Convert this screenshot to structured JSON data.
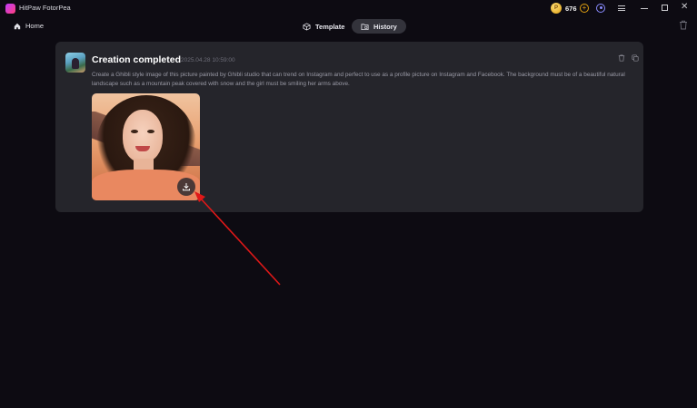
{
  "app": {
    "title": "HitPaw FotorPea",
    "credits": "676",
    "coin_symbol": "P",
    "add_symbol": "+",
    "close_symbol": "✕"
  },
  "nav": {
    "home_label": "Home",
    "tabs": [
      {
        "label": "Template",
        "icon": "cube-icon",
        "active": false
      },
      {
        "label": "History",
        "icon": "folder-clock-icon",
        "active": true
      }
    ]
  },
  "card": {
    "title": "Creation completed",
    "timestamp": "2025.04.28 10:59:00",
    "prompt": "Create a Ghibli style image of this picture painted by Ghibli studio that can trend on Instagram and perfect to use as a profile picture on Instagram and Facebook. The background must be of a beautiful natural landscape such as a mountain peak covered with snow and the girl must be smiling her arms above.",
    "image_alt": "generated Ghibli-style portrait"
  },
  "colors": {
    "accent": "#e0a010",
    "card_bg": "#25252b",
    "page_bg": "#0d0b12",
    "annotation_arrow": "#e01818"
  }
}
